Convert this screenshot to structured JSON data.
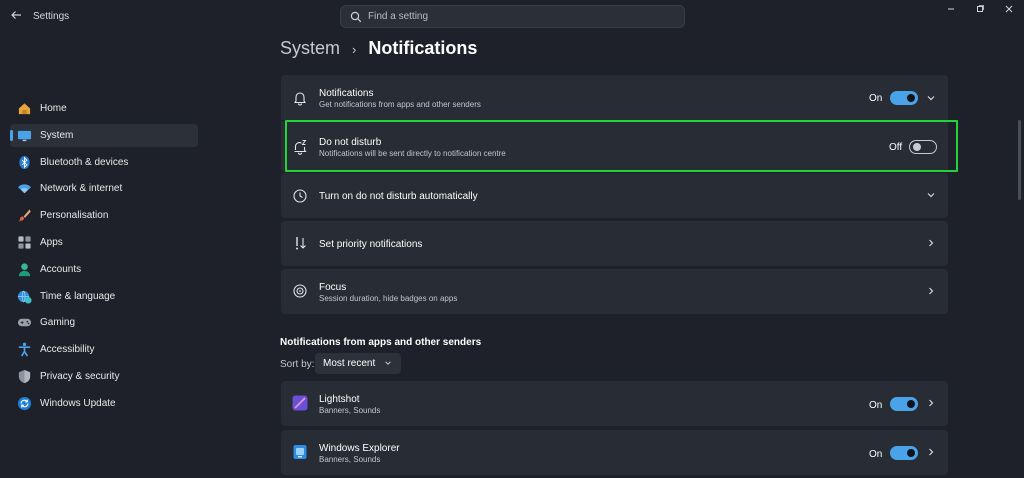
{
  "window": {
    "title": "Settings",
    "search_placeholder": "Find a setting"
  },
  "sidebar": {
    "items": [
      {
        "label": "Home",
        "icon": "home-icon"
      },
      {
        "label": "System",
        "icon": "monitor-icon",
        "active": true
      },
      {
        "label": "Bluetooth & devices",
        "icon": "bluetooth-icon"
      },
      {
        "label": "Network & internet",
        "icon": "wifi-icon"
      },
      {
        "label": "Personalisation",
        "icon": "brush-icon"
      },
      {
        "label": "Apps",
        "icon": "apps-icon"
      },
      {
        "label": "Accounts",
        "icon": "person-icon"
      },
      {
        "label": "Time & language",
        "icon": "globe-clock-icon"
      },
      {
        "label": "Gaming",
        "icon": "gamepad-icon"
      },
      {
        "label": "Accessibility",
        "icon": "accessibility-icon"
      },
      {
        "label": "Privacy & security",
        "icon": "shield-icon"
      },
      {
        "label": "Windows Update",
        "icon": "update-icon"
      }
    ]
  },
  "breadcrumb": {
    "parent": "System",
    "separator": "›",
    "current": "Notifications"
  },
  "settings": {
    "notifications": {
      "title": "Notifications",
      "subtitle": "Get notifications from apps and other senders",
      "state": "On",
      "icon": "bell-icon"
    },
    "dnd": {
      "title": "Do not disturb",
      "subtitle": "Notifications will be sent directly to notification centre",
      "state": "Off",
      "icon": "bell-snooze-icon"
    },
    "dnd_auto": {
      "title": "Turn on do not disturb automatically",
      "icon": "clock-icon"
    },
    "priority": {
      "title": "Set priority notifications",
      "icon": "priority-icon"
    },
    "focus": {
      "title": "Focus",
      "subtitle": "Session duration, hide badges on apps",
      "icon": "focus-icon"
    }
  },
  "apps_section": {
    "title": "Notifications from apps and other senders",
    "sort_label": "Sort by:",
    "sort_value": "Most recent",
    "apps": [
      {
        "name": "Lightshot",
        "subtitle": "Banners, Sounds",
        "state": "On",
        "icon": "lightshot-icon"
      },
      {
        "name": "Windows Explorer",
        "subtitle": "Banners, Sounds",
        "state": "On",
        "icon": "explorer-icon"
      }
    ]
  },
  "colors": {
    "background": "#1e2129",
    "card": "#282c34",
    "accent": "#4aa3e8",
    "highlight": "#22d33a"
  }
}
